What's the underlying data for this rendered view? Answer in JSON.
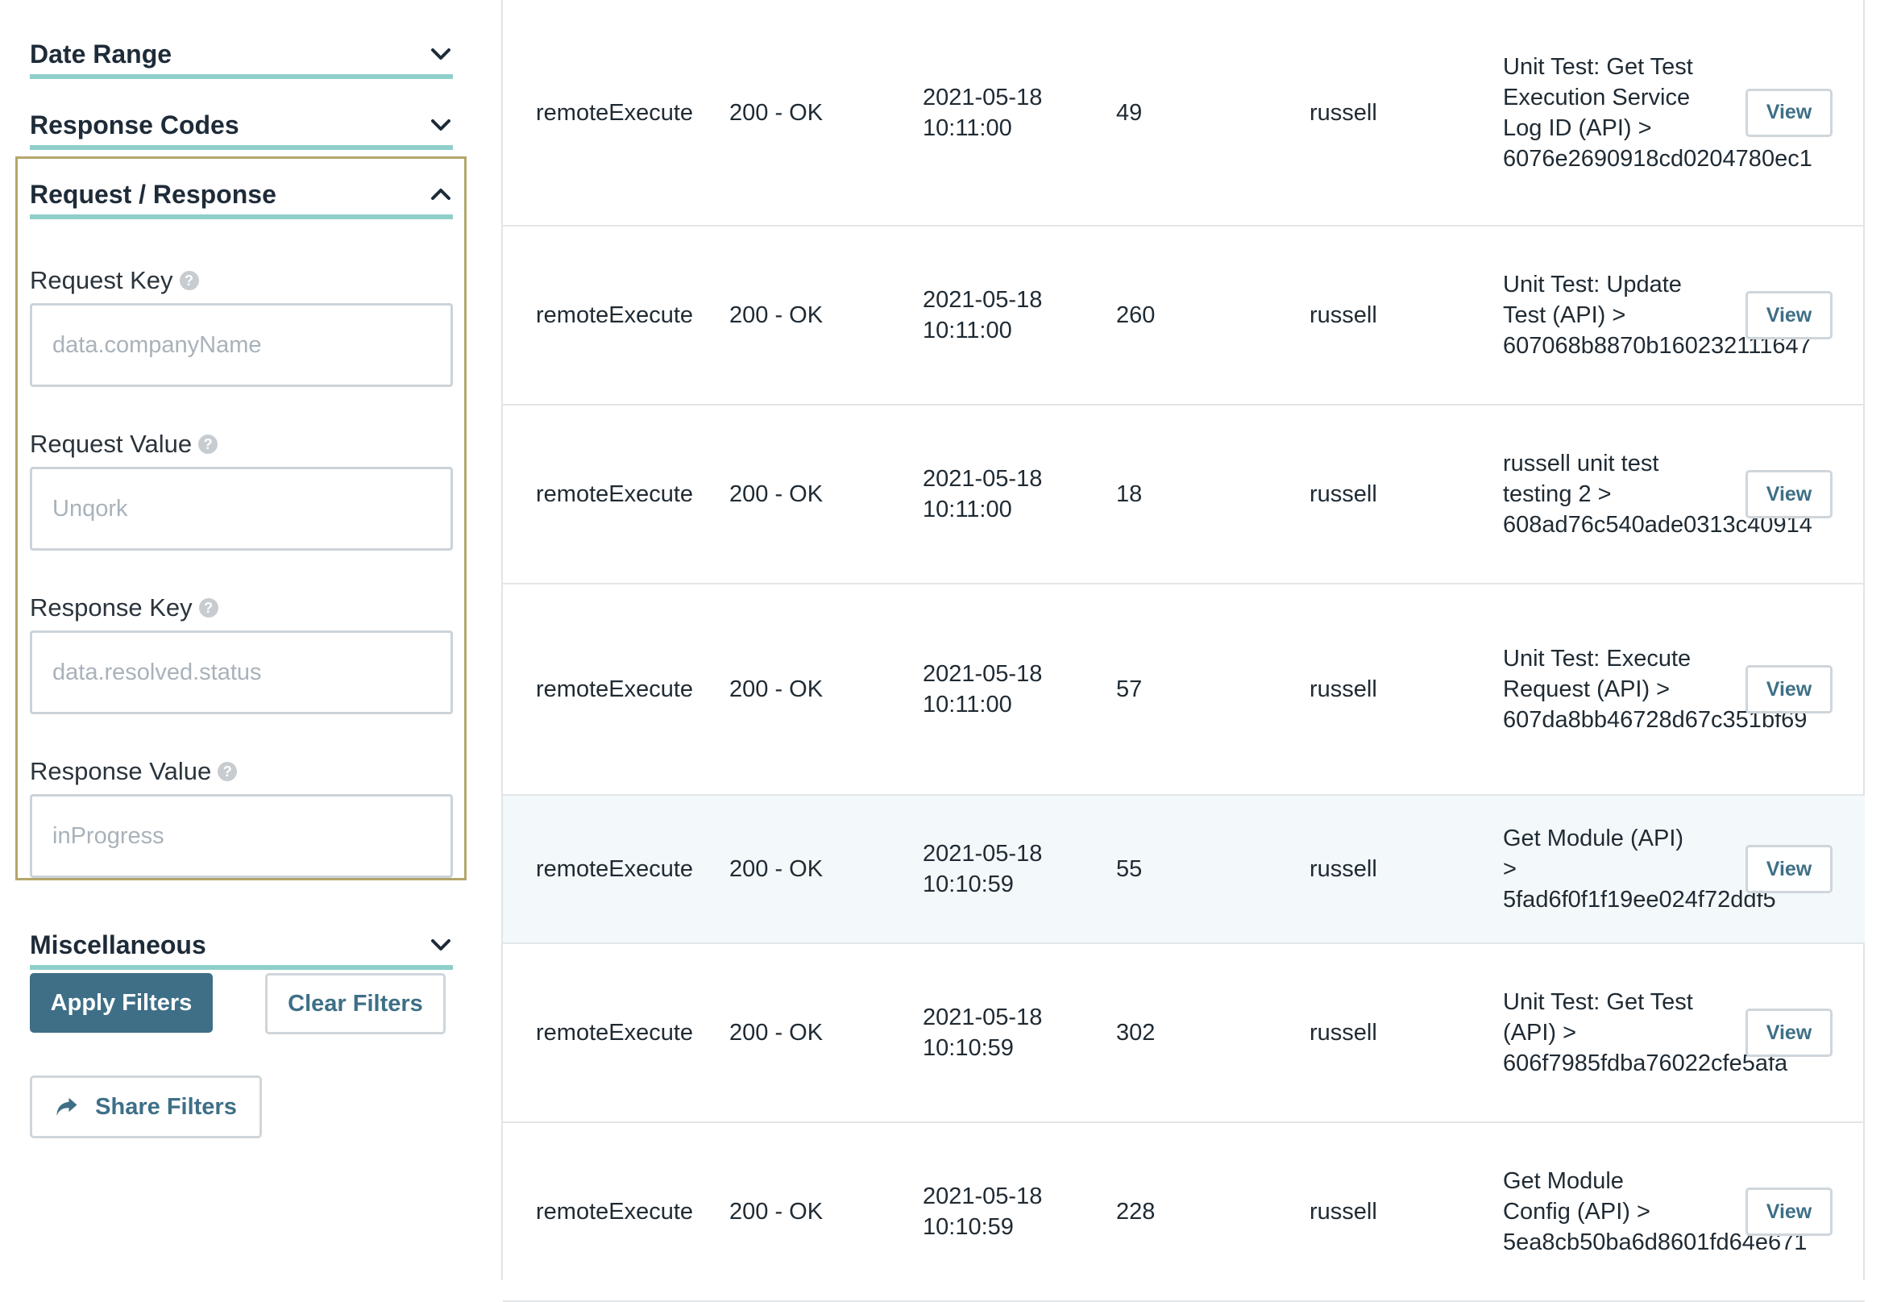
{
  "sidebar": {
    "sections": {
      "date_range": "Date Range",
      "response_codes": "Response Codes",
      "request_response": "Request / Response",
      "miscellaneous": "Miscellaneous"
    },
    "fields": {
      "request_key": {
        "label": "Request Key",
        "placeholder": "data.companyName",
        "value": ""
      },
      "request_value": {
        "label": "Request Value",
        "placeholder": "Unqork",
        "value": ""
      },
      "response_key": {
        "label": "Response Key",
        "placeholder": "data.resolved.status",
        "value": ""
      },
      "response_value": {
        "label": "Response Value",
        "placeholder": "inProgress",
        "value": ""
      }
    },
    "buttons": {
      "apply": "Apply Filters",
      "clear": "Clear Filters",
      "share": "Share Filters"
    },
    "icons": {
      "collapsed": "chevron-down-icon",
      "expanded": "chevron-up-icon",
      "help": "question-circle-icon",
      "share": "share-arrow-icon"
    },
    "colors": {
      "accent_underline": "#8fcfcb",
      "highlight_border": "#b4a66b",
      "primary_button": "#3e6f87"
    }
  },
  "table": {
    "view_label": "View",
    "rows": [
      {
        "method": "remoteExecute",
        "status": "200 - OK",
        "date": "2021-05-18",
        "time": "10:11:00",
        "duration": "49",
        "user": "russell",
        "description": "Unit Test: Get Test Execution Service Log ID (API) >",
        "id": "6076e2690918cd0204780ec1"
      },
      {
        "method": "remoteExecute",
        "status": "200 - OK",
        "date": "2021-05-18",
        "time": "10:11:00",
        "duration": "260",
        "user": "russell",
        "description": "Unit Test: Update Test (API) >",
        "id": "607068b8870b160232111647"
      },
      {
        "method": "remoteExecute",
        "status": "200 - OK",
        "date": "2021-05-18",
        "time": "10:11:00",
        "duration": "18",
        "user": "russell",
        "description": "russell unit test testing 2 >",
        "id": "608ad76c540ade0313c40914"
      },
      {
        "method": "remoteExecute",
        "status": "200 - OK",
        "date": "2021-05-18",
        "time": "10:11:00",
        "duration": "57",
        "user": "russell",
        "description": "Unit Test: Execute Request (API) >",
        "id": "607da8bb46728d67c351bf69"
      },
      {
        "method": "remoteExecute",
        "status": "200 - OK",
        "date": "2021-05-18",
        "time": "10:10:59",
        "duration": "55",
        "user": "russell",
        "description": "Get Module (API) >",
        "id": "5fad6f0f1f19ee024f72ddf5"
      },
      {
        "method": "remoteExecute",
        "status": "200 - OK",
        "date": "2021-05-18",
        "time": "10:10:59",
        "duration": "302",
        "user": "russell",
        "description": "Unit Test: Get Test (API) >",
        "id": "606f7985fdba76022cfe5afa"
      },
      {
        "method": "remoteExecute",
        "status": "200 - OK",
        "date": "2021-05-18",
        "time": "10:10:59",
        "duration": "228",
        "user": "russell",
        "description": "Get Module Config (API) >",
        "id": "5ea8cb50ba6d8601fd64e671"
      }
    ]
  }
}
